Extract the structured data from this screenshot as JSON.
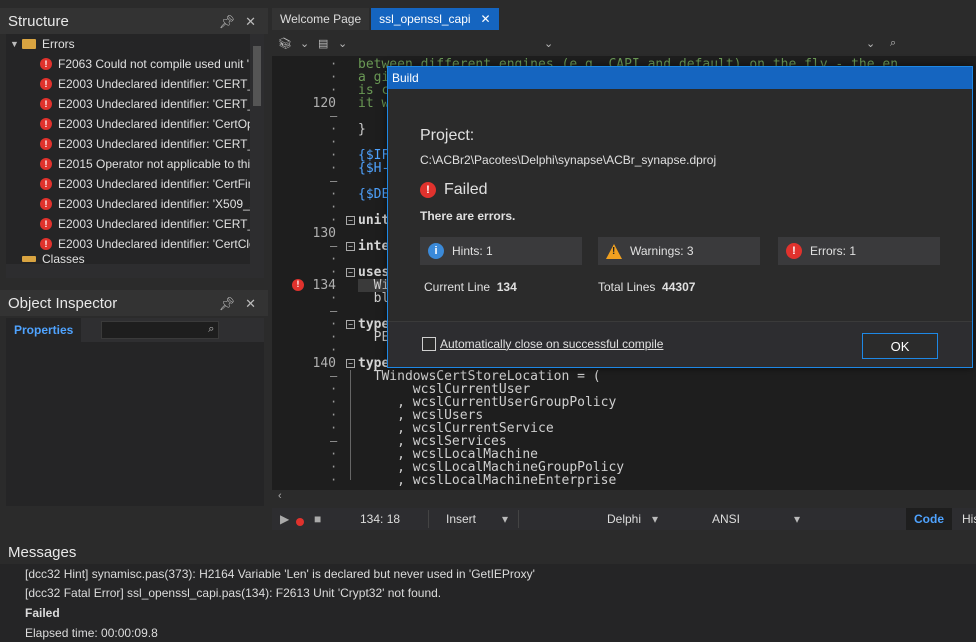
{
  "structure": {
    "title": "Structure",
    "pin_icon": "pin-icon",
    "close_icon": "close-icon",
    "root": "Errors",
    "items": [
      "F2063 Could not compile used unit '",
      "E2003 Undeclared identifier: 'CERT_S",
      "E2003 Undeclared identifier: 'CERT_S",
      "E2003 Undeclared identifier: 'CertOp",
      "E2003 Undeclared identifier: 'CERT_S",
      "E2015 Operator not applicable to thi",
      "E2003 Undeclared identifier: 'CertFin",
      "E2003 Undeclared identifier: 'X509_A",
      "E2003 Undeclared identifier: 'CERT_F",
      "E2003 Undeclared identifier: 'CertClo"
    ],
    "next_root": "Classes"
  },
  "object_inspector": {
    "title": "Object Inspector",
    "tab": "Properties"
  },
  "editor": {
    "tabs": [
      "Welcome Page",
      "ssl_openssl_capi"
    ],
    "active_tab": 1,
    "gutter_numbers": [
      {
        "n": "120",
        "line": 3
      },
      {
        "n": "130",
        "line": 13
      },
      {
        "n": "134",
        "line": 17
      },
      {
        "n": "140",
        "line": 23
      }
    ],
    "code_lines": [
      "between different engines (e.g. CAPI and default) on the fly - the en",
      "a gi",
      "is c",
      "it w",
      "",
      "}",
      "",
      "{$IF",
      "{$H-",
      "",
      "{$DE",
      "",
      "unit",
      "",
      "inte",
      "",
      "uses",
      "  Wi",
      "  bl",
      "",
      "type",
      "  PE",
      "",
      "type",
      "  TWindowsCertStoreLocation = (",
      "       wcslCurrentUser",
      "     , wcslCurrentUserGroupPolicy",
      "     , wcslUsers",
      "     , wcslCurrentService",
      "     , wcslServices",
      "     , wcslLocalMachine",
      "     , wcslLocalMachineGroupPolicy",
      "     , wcslLocalMachineEnterprise"
    ]
  },
  "statusbar": {
    "position": "134:  18",
    "mode": "Insert",
    "language": "Delphi",
    "encoding": "ANSI",
    "tab_code": "Code",
    "tab_history": "His"
  },
  "messages": {
    "title": "Messages",
    "lines": [
      "[dcc32 Hint] synamisc.pas(373): H2164 Variable 'Len' is declared but never used in 'GetIEProxy'",
      "[dcc32 Fatal Error] ssl_openssl_capi.pas(134): F2613 Unit 'Crypt32' not found.",
      "Failed",
      "Elapsed time: 00:00:09.8"
    ]
  },
  "build_dialog": {
    "title": "Build",
    "project_label": "Project:",
    "project_path": "C:\\ACBr2\\Pacotes\\Delphi\\synapse\\ACBr_synapse.dproj",
    "status": "Failed",
    "status_detail": "There are errors.",
    "hints_label": "Hints:",
    "hints_count": "1",
    "warnings_label": "Warnings:",
    "warnings_count": "3",
    "errors_label": "Errors:",
    "errors_count": "1",
    "current_line_label": "Current Line",
    "current_line": "134",
    "total_lines_label": "Total Lines",
    "total_lines": "44307",
    "auto_close_label": "Automatically close on successful compile",
    "ok_label": "OK"
  },
  "colors": {
    "accent": "#1565c0",
    "error": "#e0322d",
    "warning": "#f0a020",
    "info": "#3b8ad9"
  }
}
